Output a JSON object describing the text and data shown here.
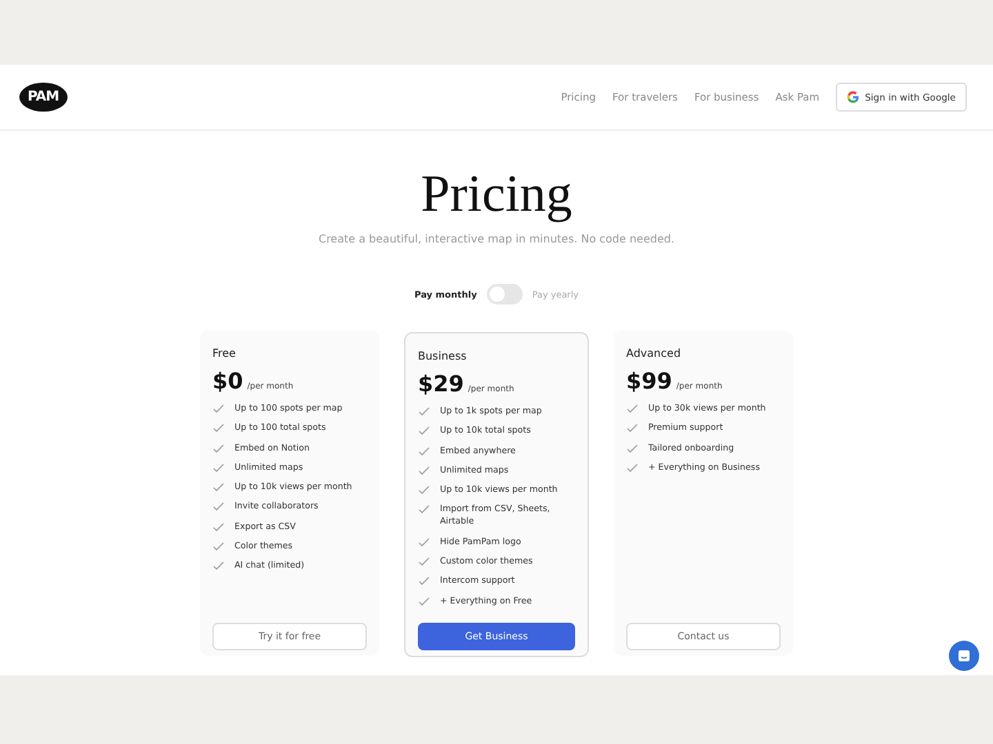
{
  "header": {
    "logo": "PAM",
    "nav": [
      "Pricing",
      "For travelers",
      "For business",
      "Ask Pam"
    ],
    "sign_in": "Sign in with Google"
  },
  "hero": {
    "title": "Pricing",
    "subtitle": "Create a beautiful, interactive map in minutes. No code needed."
  },
  "billing": {
    "labels": [
      {
        "label": "Pay monthly",
        "selected": true
      },
      {
        "label": "Pay yearly",
        "selected": false
      }
    ],
    "on": false
  },
  "plans": [
    {
      "name": "Free",
      "price": "$0",
      "period": "/per month",
      "highlighted": false,
      "features": [
        "Up to 100 spots per map",
        "Up to 100 total spots",
        "Embed on Notion",
        "Unlimited maps",
        "Up to 10k views per month",
        "Invite collaborators",
        "Export as CSV",
        "Color themes",
        "AI chat (limited)"
      ],
      "button": "Try it for free",
      "primary": false
    },
    {
      "name": "Business",
      "price": "$29",
      "period": "/per month",
      "highlighted": true,
      "features": [
        "Up to 1k spots per map",
        "Up to 10k total spots",
        "Embed anywhere",
        "Unlimited maps",
        "Up to 10k views per month",
        "Import from CSV, Sheets, Airtable",
        "Hide PamPam logo",
        "Custom color themes",
        "Intercom support",
        "+ Everything on Free"
      ],
      "button": "Get Business",
      "primary": true
    },
    {
      "name": "Advanced",
      "price": "$99",
      "period": "/per month",
      "highlighted": false,
      "features": [
        "Up to 30k views per month",
        "Premium support",
        "Tailored onboarding",
        "+ Everything on Business"
      ],
      "button": "Contact us",
      "primary": false
    }
  ]
}
